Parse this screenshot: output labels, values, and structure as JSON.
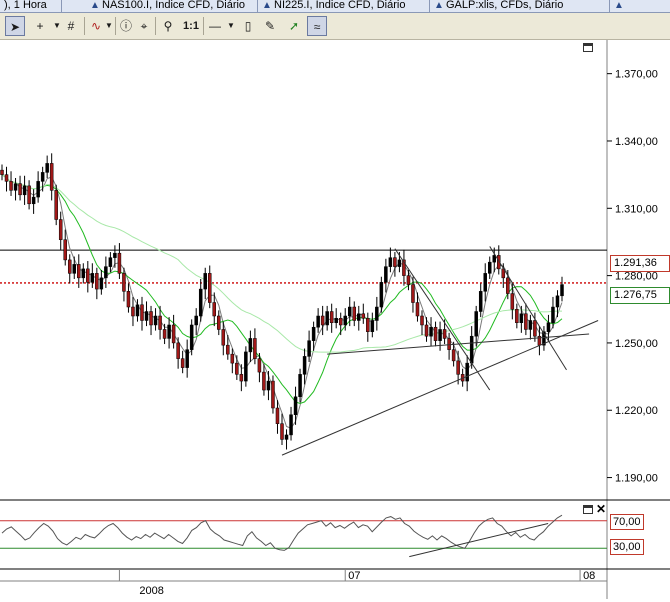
{
  "tabs": [
    {
      "label": "), 1 Hora",
      "icon": "none"
    },
    {
      "label": "NAS100.I, Índice CFD, Diário",
      "icon": "chart-icon"
    },
    {
      "label": "NI225.I, Índice CFD, Diário",
      "icon": "chart-icon"
    },
    {
      "label": "GALP:xlis, CFDs, Diário",
      "icon": "chart-icon"
    }
  ],
  "toolbar": {
    "tools": [
      "pointer-icon",
      "crosshair-icon",
      "grid-icon",
      "indicator-icon",
      "info-icon",
      "cursor-data-icon",
      "zoom-icon",
      "one-to-one-icon",
      "line-icon",
      "eraser-icon",
      "paint-icon",
      "draw-icon",
      "magnet-icon"
    ],
    "one_to_one_label": "1:1"
  },
  "price_axis": {
    "ticks": [
      "1.370,00",
      "1.340,00",
      "1.310,00",
      "1.280,00",
      "1.250,00",
      "1.220,00",
      "1.190,00"
    ]
  },
  "price_labels": {
    "resistance": "1.291,36",
    "last": "1.276,75"
  },
  "rsi_axis": {
    "upper": "70,00",
    "lower": "30,00"
  },
  "time_axis": {
    "labels": [
      "2008",
      "07",
      "08"
    ]
  },
  "colors": {
    "candle_up": "#000000",
    "candle_down": "#a01818",
    "ma_fast": "#7b7b7b",
    "ma_mid": "#22bb22",
    "ma_slow": "#a8e8a8",
    "resistance_line": "#000000",
    "last_price_line": "#cc0000",
    "rsi_upper": "#cc3333",
    "rsi_lower": "#2e8b2e"
  },
  "chart_data": {
    "type": "candlestick",
    "title": "",
    "y_range": [
      1180,
      1385
    ],
    "rsi_range": [
      0,
      100
    ],
    "price_levels": {
      "resistance": 1291.36,
      "last": 1276.75
    },
    "rsi_levels": [
      70,
      30
    ],
    "x_labels": [
      {
        "label": "2008",
        "index": 26
      },
      {
        "label": "07",
        "index": 76
      },
      {
        "label": "08",
        "index": 128
      }
    ],
    "closes": [
      1325,
      1322,
      1318,
      1321,
      1316,
      1320,
      1312,
      1315,
      1322,
      1326,
      1330,
      1318,
      1305,
      1296,
      1287,
      1281,
      1285,
      1279,
      1283,
      1277,
      1281,
      1274,
      1279,
      1284,
      1288,
      1290,
      1281,
      1273,
      1266,
      1262,
      1267,
      1260,
      1264,
      1258,
      1262,
      1256,
      1252,
      1258,
      1250,
      1243,
      1239,
      1247,
      1258,
      1262,
      1274,
      1281,
      1268,
      1262,
      1256,
      1249,
      1245,
      1241,
      1236,
      1233,
      1246,
      1252,
      1243,
      1237,
      1229,
      1233,
      1221,
      1214,
      1207,
      1209,
      1218,
      1226,
      1236,
      1244,
      1251,
      1257,
      1262,
      1258,
      1264,
      1259,
      1261,
      1258,
      1262,
      1266,
      1260,
      1263,
      1261,
      1255,
      1260,
      1266,
      1277,
      1284,
      1288,
      1284,
      1287,
      1280,
      1276,
      1268,
      1262,
      1258,
      1253,
      1257,
      1251,
      1256,
      1252,
      1247,
      1242,
      1236,
      1233,
      1241,
      1253,
      1264,
      1273,
      1281,
      1286,
      1289,
      1283,
      1279,
      1272,
      1265,
      1259,
      1263,
      1256,
      1260,
      1253,
      1249,
      1255,
      1259,
      1266,
      1271,
      1276
    ],
    "rsi": [
      52,
      58,
      61,
      55,
      49,
      42,
      45,
      53,
      60,
      66,
      62,
      55,
      44,
      38,
      35,
      40,
      46,
      43,
      50,
      47,
      45,
      51,
      58,
      63,
      66,
      60,
      52,
      46,
      42,
      47,
      44,
      50,
      46,
      52,
      48,
      44,
      50,
      45,
      40,
      37,
      45,
      56,
      60,
      67,
      70,
      58,
      52,
      48,
      42,
      40,
      38,
      36,
      34,
      48,
      54,
      45,
      40,
      34,
      38,
      30,
      28,
      27,
      31,
      42,
      52,
      58,
      64,
      66,
      68,
      70,
      62,
      67,
      60,
      63,
      59,
      64,
      68,
      60,
      64,
      62,
      54,
      61,
      68,
      74,
      76,
      72,
      74,
      66,
      62,
      55,
      50,
      46,
      43,
      48,
      42,
      48,
      44,
      39,
      35,
      32,
      30,
      40,
      52,
      62,
      68,
      72,
      74,
      66,
      62,
      54,
      48,
      53,
      46,
      50,
      44,
      42,
      49,
      54,
      62,
      68,
      74,
      78
    ]
  }
}
